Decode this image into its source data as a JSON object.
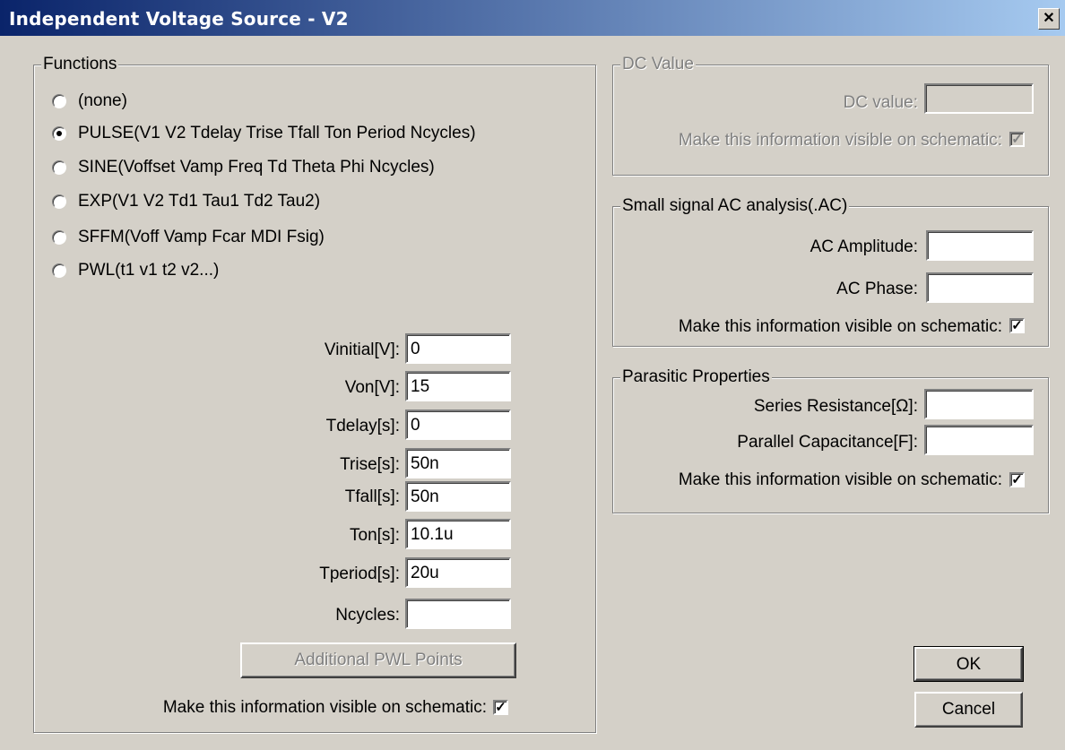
{
  "window": {
    "title": "Independent Voltage Source - V2",
    "close_glyph": "✕"
  },
  "functions": {
    "legend": "Functions",
    "options": [
      {
        "label": "(none)",
        "checked": false
      },
      {
        "label": "PULSE(V1 V2 Tdelay Trise Tfall Ton Period Ncycles)",
        "checked": true
      },
      {
        "label": "SINE(Voffset Vamp Freq Td Theta Phi Ncycles)",
        "checked": false
      },
      {
        "label": "EXP(V1 V2 Td1 Tau1 Td2 Tau2)",
        "checked": false
      },
      {
        "label": "SFFM(Voff Vamp Fcar MDI Fsig)",
        "checked": false
      },
      {
        "label": "PWL(t1 v1 t2 v2...)",
        "checked": false
      }
    ],
    "params": [
      {
        "label": "Vinitial[V]:",
        "value": "0"
      },
      {
        "label": "Von[V]:",
        "value": "15"
      },
      {
        "label": "Tdelay[s]:",
        "value": "0"
      },
      {
        "label": "Trise[s]:",
        "value": "50n"
      },
      {
        "label": "Tfall[s]:",
        "value": "50n"
      },
      {
        "label": "Ton[s]:",
        "value": "10.1u"
      },
      {
        "label": "Tperiod[s]:",
        "value": "20u"
      },
      {
        "label": "Ncycles:",
        "value": ""
      }
    ],
    "pwl_button": "Additional PWL Points",
    "visible_label": "Make this information visible on schematic:",
    "visible_checked": "✓"
  },
  "dc": {
    "legend": "DC Value",
    "value_label": "DC value:",
    "value": "",
    "visible_label": "Make this information visible on schematic:",
    "visible_checked": "✓"
  },
  "ac": {
    "legend": "Small signal AC analysis(.AC)",
    "amplitude_label": "AC Amplitude:",
    "amplitude": "",
    "phase_label": "AC Phase:",
    "phase": "",
    "visible_label": "Make this information visible on schematic:",
    "visible_checked": "✓"
  },
  "parasitic": {
    "legend": "Parasitic Properties",
    "series_label": "Series Resistance[Ω]:",
    "series": "",
    "parallel_label": "Parallel Capacitance[F]:",
    "parallel": "",
    "visible_label": "Make this information visible on schematic:",
    "visible_checked": "✓"
  },
  "buttons": {
    "ok": "OK",
    "cancel": "Cancel"
  }
}
